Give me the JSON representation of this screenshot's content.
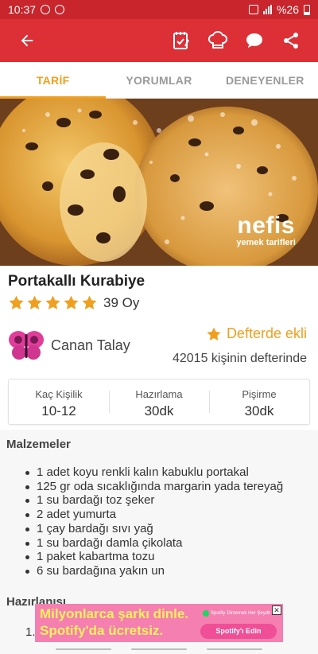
{
  "status_bar": {
    "time": "10:37",
    "battery": "%26"
  },
  "app_bar": {
    "back_icon": "arrow-left-icon",
    "actions": [
      "notebook-check-icon",
      "chef-hat-icon",
      "chat-bubble-icon",
      "share-icon"
    ]
  },
  "tabs": [
    {
      "label": "TARİF",
      "active": true
    },
    {
      "label": "YORUMLAR",
      "active": false
    },
    {
      "label": "DENEYENLER",
      "active": false
    }
  ],
  "hero": {
    "brand": "nefis",
    "brand_sub": "yemek tarifleri"
  },
  "recipe": {
    "title": "Portakallı Kurabiye",
    "rating_stars": 5,
    "rating_label": "39 Oy"
  },
  "author": {
    "name": "Canan Talay"
  },
  "favorite": {
    "label": "Defterde ekli",
    "count_text": "42015 kişinin defterinde"
  },
  "info": [
    {
      "label": "Kaç Kişilik",
      "value": "10-12"
    },
    {
      "label": "Hazırlama",
      "value": "30dk"
    },
    {
      "label": "Pişirme",
      "value": "30dk"
    }
  ],
  "ingredients": {
    "title": "Malzemeler",
    "items": [
      "1 adet koyu renkli kalın kabuklu portakal",
      "125 gr oda sıcaklığında margarin yada tereyağ",
      "1 su bardağı toz şeker",
      "2 adet yumurta",
      "1 çay bardağı sıvı yağ",
      "1 su bardağı damla çikolata",
      "1 paket kabartma tozu",
      "6 su bardağına yakın un"
    ]
  },
  "preparation": {
    "title": "Hazırlanışı",
    "first_step_number": "1."
  },
  "ad": {
    "line1": "Milyonlarca şarkı dinle.",
    "line2": "Spotify'da ücretsiz.",
    "brand": "Spotify",
    "tagline": "Dinlemek Her Şeydir",
    "cta": "Spotify'ı Edin",
    "close": "✕"
  },
  "colors": {
    "primary": "#dc3036",
    "accent": "#f0a020"
  }
}
